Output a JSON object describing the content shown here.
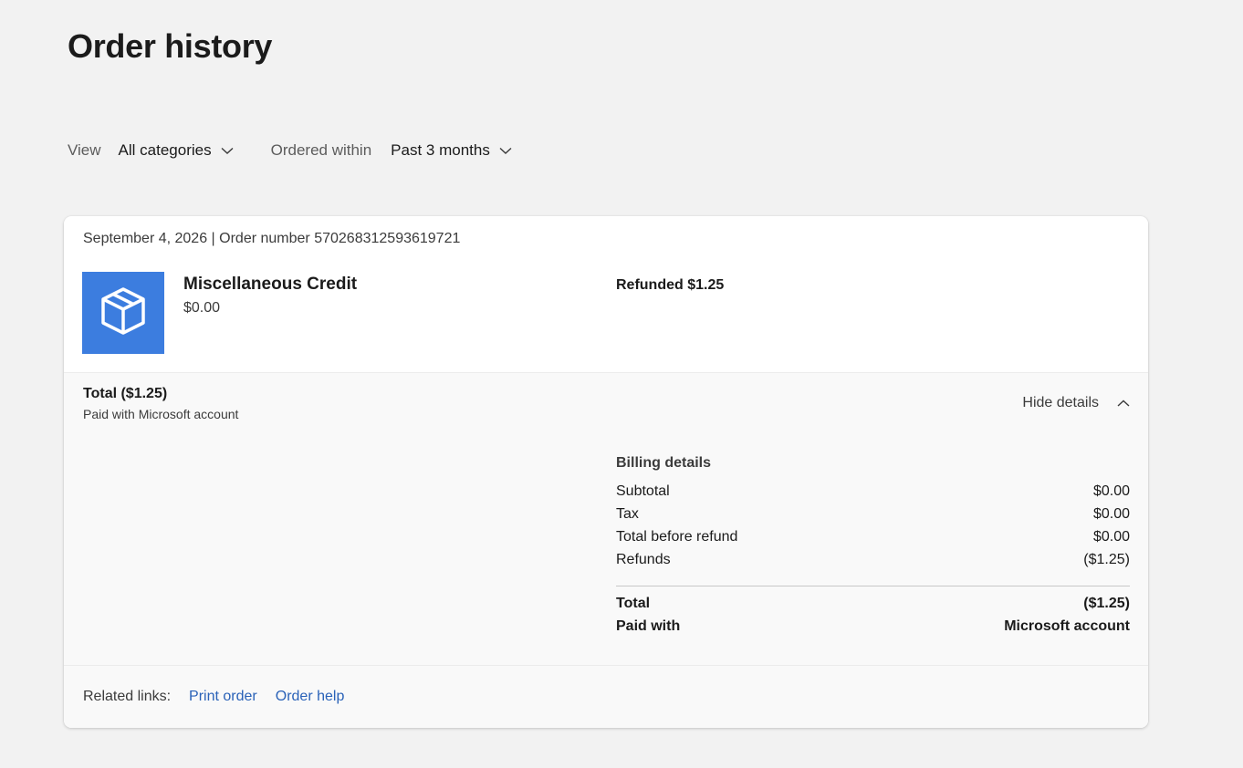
{
  "page": {
    "title": "Order history"
  },
  "filters": {
    "view_label": "View",
    "view_value": "All categories",
    "ordered_within_label": "Ordered within",
    "ordered_within_value": "Past 3 months"
  },
  "order": {
    "date": "September 4, 2026",
    "separator": "|",
    "number_label": "Order number",
    "number": "570268312593619721",
    "product": {
      "icon": "box-icon",
      "name": "Miscellaneous Credit",
      "price": "$0.00"
    },
    "status": "Refunded $1.25",
    "total": "Total ($1.25)",
    "paid_note": "Paid with Microsoft account",
    "hide_details_label": "Hide details",
    "billing": {
      "heading": "Billing details",
      "rows": [
        {
          "label": "Subtotal",
          "value": "$0.00"
        },
        {
          "label": "Tax",
          "value": "$0.00"
        },
        {
          "label": "Total before refund",
          "value": "$0.00"
        },
        {
          "label": "Refunds",
          "value": "($1.25)"
        }
      ],
      "total_label": "Total",
      "total_value": "($1.25)",
      "paid_with_label": "Paid with",
      "paid_with_value": "Microsoft account"
    },
    "related": {
      "label": "Related links:",
      "links": [
        "Print order",
        "Order help"
      ]
    }
  },
  "colors": {
    "page_bg": "#f2f2f2",
    "accent_tile": "#3c7ddf",
    "link": "#2a62b8"
  }
}
